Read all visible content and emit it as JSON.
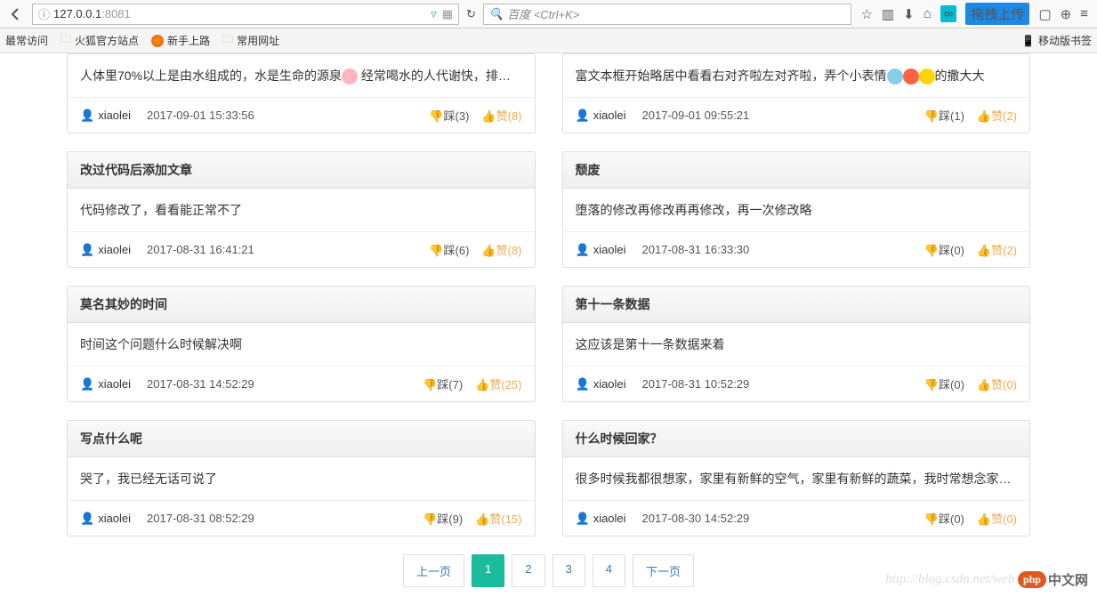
{
  "browser": {
    "url_host": "127.0.0.1",
    "url_port": ":8081",
    "search_placeholder": "百度 <Ctrl+K>",
    "ext_label": "拖拽上传"
  },
  "bookmarks": {
    "most_visited": "最常访问",
    "firefox_official": "火狐官方站点",
    "getting_started": "新手上路",
    "common_sites": "常用网址",
    "mobile": "移动版书签"
  },
  "cards": [
    [
      {
        "title": "",
        "body_prefix": "人体里70%以上是由水组成的，水是生命的源泉",
        "body_suffix": "  经常喝水的人代谢快，排毒 ...",
        "emoji_class": "emoji-pink",
        "author": "xiaolei",
        "time": "2017-09-01 15:33:56",
        "down": "踩(3)",
        "up": "赞(8)"
      },
      {
        "title": "",
        "body_prefix": "富文本框开始略居中看看右对齐啦左对齐啦，弄个小表情",
        "body_suffix": "的撒大大",
        "emoji_multi": true,
        "author": "xiaolei",
        "time": "2017-09-01 09:55:21",
        "down": "踩(1)",
        "up": "赞(2)"
      }
    ],
    [
      {
        "title": "改过代码后添加文章",
        "body": "代码修改了，看看能正常不了",
        "author": "xiaolei",
        "time": "2017-08-31 16:41:21",
        "down": "踩(6)",
        "up": "赞(8)"
      },
      {
        "title": "颓废",
        "body": "堕落的修改再修改再再修改，再一次修改略",
        "author": "xiaolei",
        "time": "2017-08-31 16:33:30",
        "down": "踩(0)",
        "up": "赞(2)"
      }
    ],
    [
      {
        "title": "莫名其妙的时间",
        "body": "时间这个问题什么时候解决啊",
        "author": "xiaolei",
        "time": "2017-08-31 14:52:29",
        "down": "踩(7)",
        "up": "赞(25)"
      },
      {
        "title": "第十一条数据",
        "body": "这应该是第十一条数据来着",
        "author": "xiaolei",
        "time": "2017-08-31 10:52:29",
        "down": "踩(0)",
        "up": "赞(0)"
      }
    ],
    [
      {
        "title": "写点什么呢",
        "body": "哭了，我已经无话可说了",
        "author": "xiaolei",
        "time": "2017-08-31 08:52:29",
        "down": "踩(9)",
        "up": "赞(15)"
      },
      {
        "title": "什么时候回家？",
        "body": "很多时候我都很想家，家里有新鲜的空气，家里有新鲜的蔬菜，我时常想念家乡 ...",
        "author": "xiaolei",
        "time": "2017-08-30 14:52:29",
        "down": "踩(0)",
        "up": "赞(0)"
      }
    ]
  ],
  "pagination": {
    "prev": "上一页",
    "pages": [
      "1",
      "2",
      "3",
      "4"
    ],
    "active": 0,
    "next": "下一页"
  },
  "watermark": {
    "url": "http://blog.csdn.net/web",
    "php": "php",
    "cn": "中文网"
  }
}
